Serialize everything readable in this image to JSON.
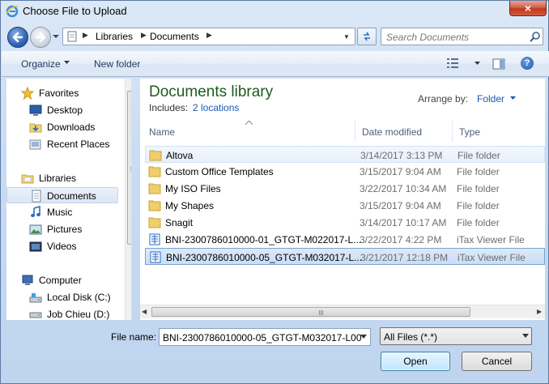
{
  "window": {
    "title": "Choose File to Upload",
    "close_label": "×"
  },
  "address": {
    "crumbs": [
      "Libraries",
      "Documents"
    ],
    "search_placeholder": "Search Documents"
  },
  "toolbar": {
    "organize_label": "Organize",
    "new_folder_label": "New folder",
    "help_label": "?"
  },
  "nav": {
    "items": [
      {
        "label": "Favorites",
        "icon": "star-icon"
      },
      {
        "label": "Desktop",
        "icon": "desktop-icon"
      },
      {
        "label": "Downloads",
        "icon": "downloads-icon"
      },
      {
        "label": "Recent Places",
        "icon": "recent-places-icon"
      },
      {
        "label": "Libraries",
        "icon": "libraries-icon"
      },
      {
        "label": "Documents",
        "icon": "documents-icon",
        "selected": true
      },
      {
        "label": "Music",
        "icon": "music-icon"
      },
      {
        "label": "Pictures",
        "icon": "pictures-icon"
      },
      {
        "label": "Videos",
        "icon": "videos-icon"
      },
      {
        "label": "Computer",
        "icon": "computer-icon"
      },
      {
        "label": "Local Disk (C:)",
        "icon": "disk-icon"
      },
      {
        "label": "Job Chieu (D:)",
        "icon": "disk-icon"
      }
    ]
  },
  "library": {
    "title": "Documents library",
    "includes_label": "Includes:",
    "includes_link": "2 locations",
    "arrange_label": "Arrange by:",
    "arrange_value": "Folder"
  },
  "columns": {
    "name": "Name",
    "date": "Date modified",
    "type": "Type"
  },
  "files": [
    {
      "name": "Altova",
      "date": "3/14/2017 3:13 PM",
      "type": "File folder",
      "icon": "folder-icon",
      "state": "hover"
    },
    {
      "name": "Custom Office Templates",
      "date": "3/15/2017 9:04 AM",
      "type": "File folder",
      "icon": "folder-icon"
    },
    {
      "name": "My ISO Files",
      "date": "3/22/2017 10:34 AM",
      "type": "File folder",
      "icon": "folder-icon"
    },
    {
      "name": "My Shapes",
      "date": "3/15/2017 9:04 AM",
      "type": "File folder",
      "icon": "folder-icon"
    },
    {
      "name": "Snagit",
      "date": "3/14/2017 10:17 AM",
      "type": "File folder",
      "icon": "folder-icon"
    },
    {
      "name": "BNI-2300786010000-01_GTGT-M022017-L...",
      "date": "3/22/2017 4:22 PM",
      "type": "iTax Viewer File",
      "icon": "itax-file-icon"
    },
    {
      "name": "BNI-2300786010000-05_GTGT-M032017-L...",
      "date": "3/21/2017 12:18 PM",
      "type": "iTax Viewer File",
      "icon": "itax-file-icon",
      "state": "selected"
    }
  ],
  "bottom": {
    "file_name_label": "File name:",
    "file_name_value": "BNI-2300786010000-05_GTGT-M032017-L00",
    "filter_value": "All Files (*.*)",
    "open_label": "Open",
    "cancel_label": "Cancel"
  },
  "colors": {
    "accent_link": "#1a58b7",
    "library_title": "#1d5b1d",
    "selection": "#c9ddf6",
    "close_button": "#c0391f"
  }
}
